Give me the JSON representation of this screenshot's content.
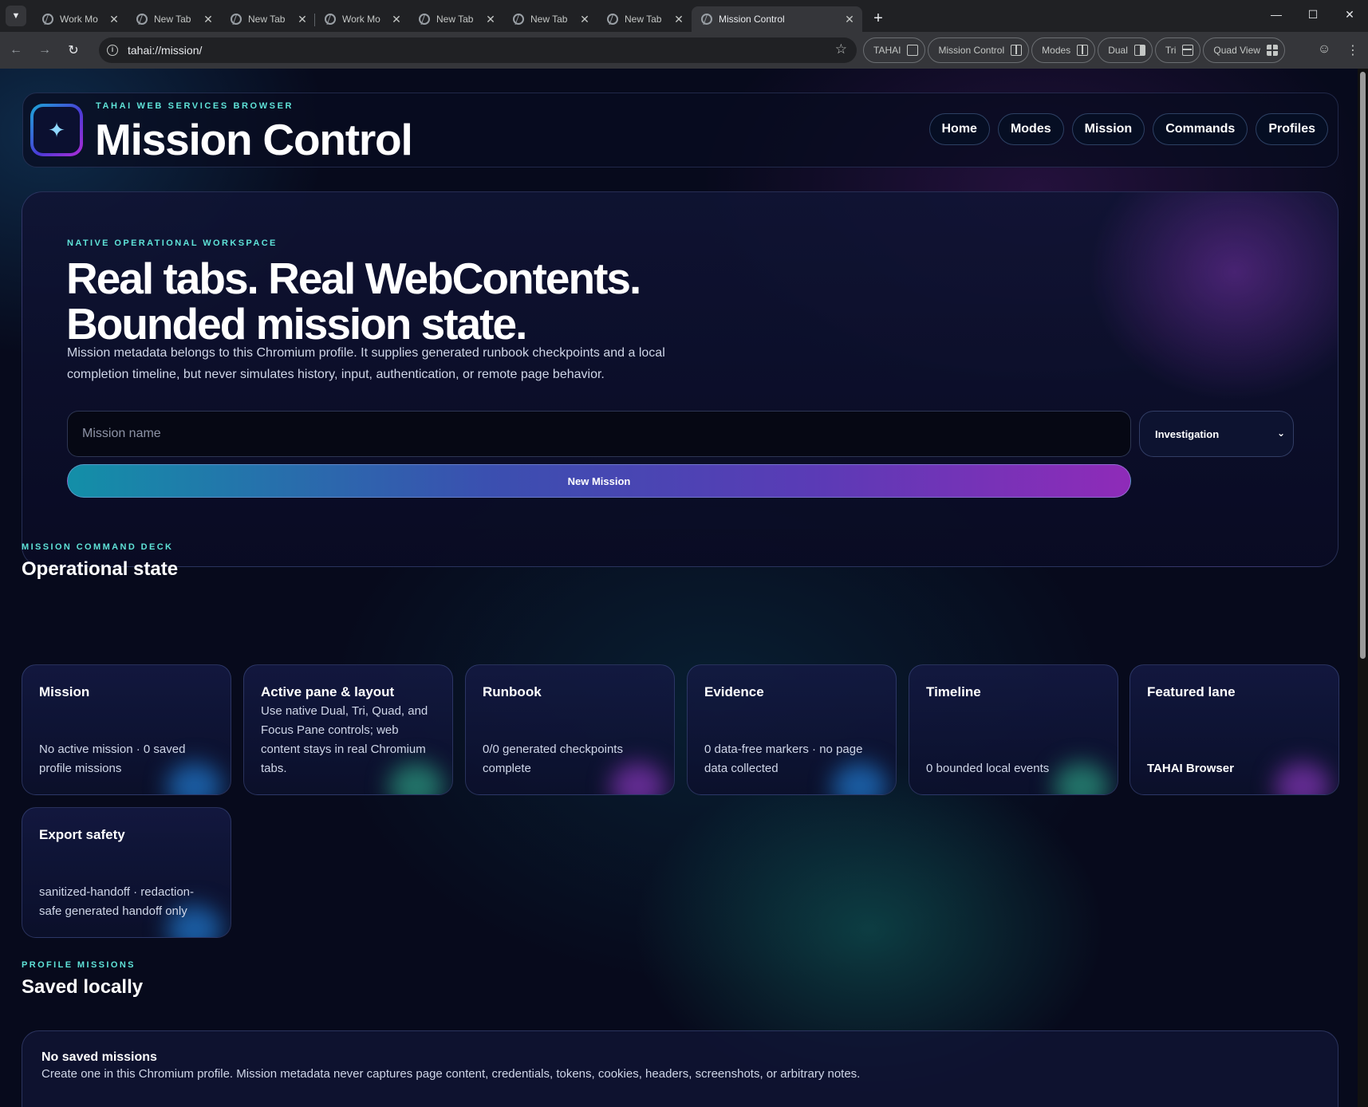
{
  "browser": {
    "tabs": [
      {
        "title": "Work Mo",
        "active": false
      },
      {
        "title": "New Tab",
        "active": false
      },
      {
        "title": "New Tab",
        "active": false
      },
      {
        "title": "Work Mo",
        "active": false
      },
      {
        "title": "New Tab",
        "active": false
      },
      {
        "title": "New Tab",
        "active": false
      },
      {
        "title": "New Tab",
        "active": false
      },
      {
        "title": "Mission Control",
        "active": true
      }
    ],
    "url": "tahai://mission/",
    "extensions": [
      {
        "label": "TAHAI",
        "icon": "home-icon"
      },
      {
        "label": "Mission Control",
        "icon": "layout-icon"
      },
      {
        "label": "Modes",
        "icon": "layout-icon"
      },
      {
        "label": "Dual",
        "icon": "dual-pane-icon"
      },
      {
        "label": "Tri",
        "icon": "tri-pane-icon"
      },
      {
        "label": "Quad View",
        "icon": "grid-icon"
      }
    ]
  },
  "header": {
    "kicker": "TAHAI WEB SERVICES BROWSER",
    "title": "Mission Control",
    "nav": [
      "Home",
      "Modes",
      "Mission",
      "Commands",
      "Profiles"
    ]
  },
  "hero": {
    "kicker": "NATIVE OPERATIONAL WORKSPACE",
    "title_line1": "Real tabs. Real WebContents.",
    "title_line2": "Bounded mission state.",
    "description": "Mission metadata belongs to this Chromium profile. It supplies generated runbook checkpoints and a local completion timeline, but never simulates history, input, authentication, or remote page behavior.",
    "input_placeholder": "Mission name",
    "input_value": "",
    "select_value": "Investigation",
    "button_label": "New Mission"
  },
  "deck": {
    "kicker": "MISSION COMMAND DECK",
    "title": "Operational state",
    "cards": [
      {
        "title": "Mission",
        "body": "No active mission · 0 saved profile missions"
      },
      {
        "title": "Active pane & layout",
        "body": "Use native Dual, Tri, Quad, and Focus Pane controls; web content stays in real Chromium tabs."
      },
      {
        "title": "Runbook",
        "body": "0/0 generated checkpoints complete"
      },
      {
        "title": "Evidence",
        "body": "0 data-free markers · no page data collected"
      },
      {
        "title": "Timeline",
        "body": "0 bounded local events"
      },
      {
        "title": "Featured lane",
        "body": "TAHAI Browser"
      },
      {
        "title": "Export safety",
        "body": "sanitized-handoff · redaction-safe generated handoff only"
      }
    ]
  },
  "saved": {
    "kicker": "PROFILE MISSIONS",
    "title": "Saved locally",
    "empty_title": "No saved missions",
    "empty_desc": "Create one in this Chromium profile. Mission metadata never captures page content, credentials, tokens, cookies, headers, screenshots, or arbitrary notes."
  },
  "colors": {
    "accent_cyan": "#5fe3d8",
    "page_bg": "#070a1c",
    "button_gradient_start": "#138fa8",
    "button_gradient_end": "#8f2bb8"
  }
}
